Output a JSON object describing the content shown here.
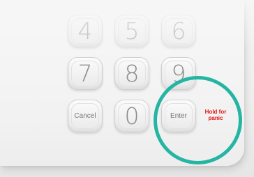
{
  "keypad": {
    "keys": {
      "k4": "4",
      "k5": "5",
      "k6": "6",
      "k7": "7",
      "k8": "8",
      "k9": "9",
      "cancel": "Cancel",
      "k0": "0",
      "enter": "Enter"
    },
    "panic_label": "Hold for panic"
  },
  "colors": {
    "highlight_ring": "#24b5a3",
    "panic_text": "#e01414"
  }
}
